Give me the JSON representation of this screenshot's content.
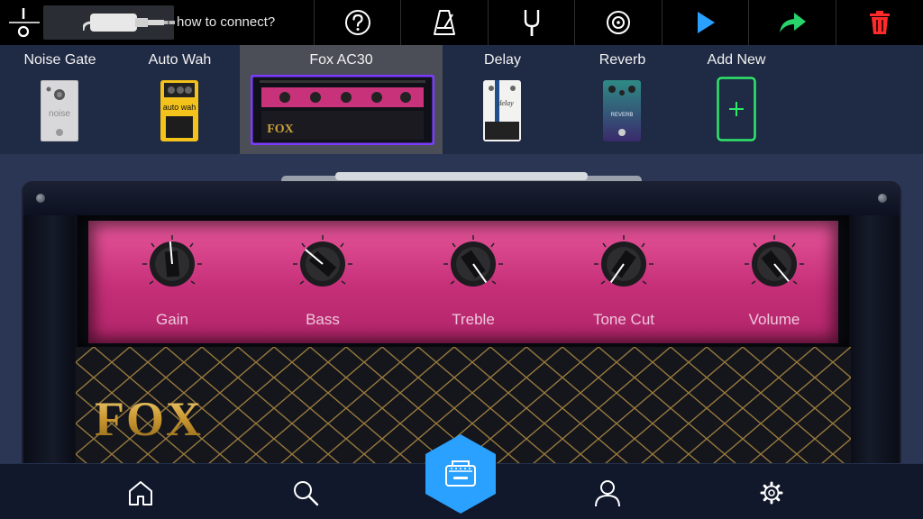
{
  "toolbar": {
    "power_icon": "power-switch-icon",
    "connect_text": "how to connect?",
    "buttons": [
      {
        "name": "help",
        "icon": "question-mark-icon"
      },
      {
        "name": "metronome",
        "icon": "metronome-icon"
      },
      {
        "name": "tuner",
        "icon": "tuning-fork-icon"
      },
      {
        "name": "record",
        "icon": "record-disc-icon"
      },
      {
        "name": "play",
        "icon": "play-icon",
        "color": "#2aa0ff"
      },
      {
        "name": "share",
        "icon": "share-arrow-icon",
        "color": "#27d36a"
      },
      {
        "name": "delete",
        "icon": "trash-icon",
        "color": "#ff2a2a"
      }
    ]
  },
  "chain": {
    "slots": [
      {
        "label": "Noise Gate",
        "thumb_text": "noise"
      },
      {
        "label": "Auto Wah",
        "thumb_text": "auto wah"
      },
      {
        "label": "Fox AC30",
        "thumb_text": "FOX",
        "selected": true
      },
      {
        "label": "Delay",
        "thumb_text": "delay"
      },
      {
        "label": "Reverb",
        "thumb_text": "REVERB"
      },
      {
        "label": "Add New",
        "thumb_text": "+"
      }
    ],
    "accent_selected": "#7b3cff",
    "add_color": "#2ee86a"
  },
  "amp": {
    "brand": "FOX",
    "panel_color": "#c8327a",
    "knobs": [
      {
        "label": "Gain"
      },
      {
        "label": "Bass"
      },
      {
        "label": "Treble"
      },
      {
        "label": "Tone Cut"
      },
      {
        "label": "Volume"
      }
    ]
  },
  "bottom_nav": {
    "items": [
      {
        "name": "home",
        "icon": "home-icon"
      },
      {
        "name": "search",
        "icon": "search-icon"
      },
      {
        "name": "amp",
        "icon": "amp-icon",
        "color": "#2aa0ff",
        "active": true
      },
      {
        "name": "profile",
        "icon": "profile-icon"
      },
      {
        "name": "settings",
        "icon": "gear-icon"
      }
    ]
  }
}
